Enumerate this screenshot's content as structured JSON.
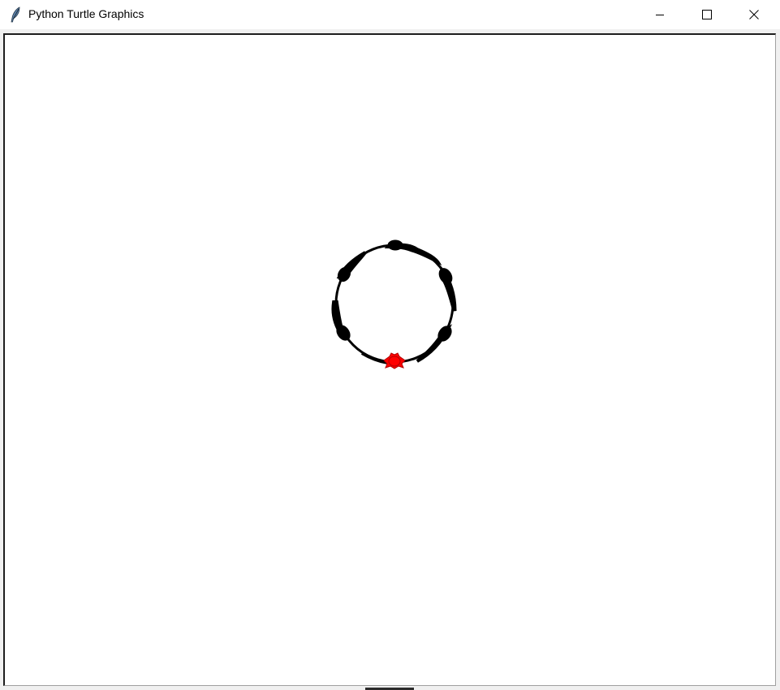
{
  "window": {
    "title": "Python Turtle Graphics",
    "app_icon": "feather-icon"
  },
  "controls": {
    "minimize_icon": "minimize-icon",
    "maximize_icon": "maximize-icon",
    "close_icon": "close-icon"
  },
  "canvas": {
    "background": "#ffffff",
    "pen_color": "#000000",
    "turtle_fill": "#ff0000",
    "turtle_outline": "#c00000",
    "turtle_shape": "turtle"
  }
}
